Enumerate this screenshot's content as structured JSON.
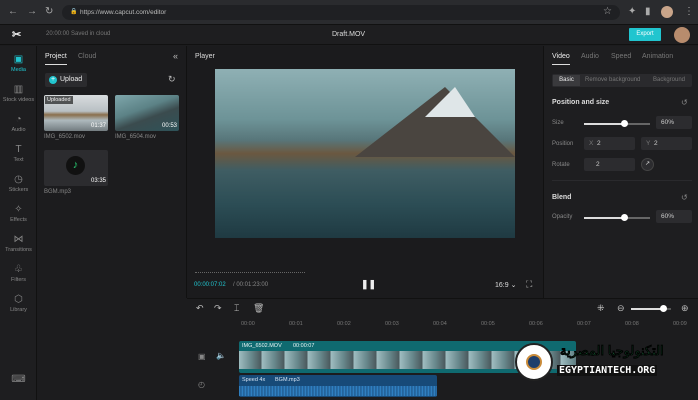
{
  "browser": {
    "url": "https://www.capcut.com/editor"
  },
  "header": {
    "save_status": "20:00:00 Saved in cloud",
    "title": "Draft.MOV",
    "export_label": "Export"
  },
  "rail": {
    "items": [
      {
        "label": "Media",
        "icon": "media-icon"
      },
      {
        "label": "Stock videos",
        "icon": "film-icon"
      },
      {
        "label": "Audio",
        "icon": "audio-icon"
      },
      {
        "label": "Text",
        "icon": "text-icon"
      },
      {
        "label": "Stickers",
        "icon": "sticker-icon"
      },
      {
        "label": "Effects",
        "icon": "effects-icon"
      },
      {
        "label": "Transitions",
        "icon": "transitions-icon"
      },
      {
        "label": "Filters",
        "icon": "filters-icon"
      },
      {
        "label": "Library",
        "icon": "library-icon"
      }
    ]
  },
  "media": {
    "tabs": [
      "Project",
      "Cloud"
    ],
    "upload_label": "Upload",
    "items": [
      {
        "name": "IMG_6502.mov",
        "duration": "01:37",
        "badge": "Uploaded"
      },
      {
        "name": "IMG_6504.mov",
        "duration": "00:53"
      },
      {
        "name": "BGM.mp3",
        "duration": "03:35"
      }
    ]
  },
  "player": {
    "title": "Player",
    "current_time": "00:00:07:02",
    "total_time": "/ 00:01:23:00",
    "ratio": "16:9",
    "progress": 0.09
  },
  "right": {
    "tabs": [
      "Video",
      "Audio",
      "Speed",
      "Animation"
    ],
    "subtabs": [
      "Basic",
      "Remove background",
      "Background"
    ],
    "position_size": "Position and size",
    "size_label": "Size",
    "size_value": "60%",
    "size_fraction": 0.6,
    "position_label": "Position",
    "x_label": "X",
    "x_value": "2",
    "y_label": "Y",
    "y_value": "2",
    "rotate_label": "Rotate",
    "rotate_value": "2",
    "blend": "Blend",
    "opacity_label": "Opacity",
    "opacity_value": "60%",
    "opacity_fraction": 0.6
  },
  "timeline": {
    "ticks": [
      "00:00",
      "00:01",
      "00:02",
      "00:03",
      "00:04",
      "00:05",
      "00:06",
      "00:07",
      "00:08",
      "00:09"
    ],
    "video_clip": {
      "name": "IMG_6502.MOV",
      "duration": "00:00:07"
    },
    "audio_clip": {
      "speed": "Speed 4x",
      "name": "BGM.mp3"
    }
  },
  "watermark": {
    "arabic": "التكنولوجيا المصرية",
    "site": "EGYPTIANTECH.ORG"
  },
  "colors": {
    "accent": "#21c5cf",
    "video_clip": "#0f6a70",
    "audio_clip": "#174a78"
  }
}
